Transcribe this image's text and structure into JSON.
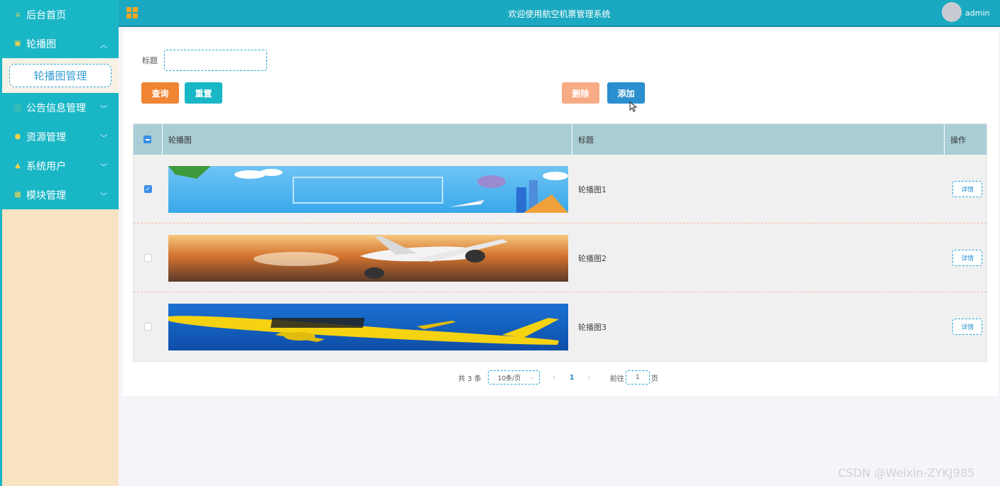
{
  "sidebar": {
    "items": [
      {
        "label": "后台首页",
        "icon": "home-icon"
      },
      {
        "label": "轮播图",
        "icon": "image-icon",
        "expanded": true
      },
      {
        "label": "公告信息管理",
        "icon": "info-icon"
      },
      {
        "label": "资源管理",
        "icon": "pin-icon"
      },
      {
        "label": "系统用户",
        "icon": "user-icon"
      },
      {
        "label": "模块管理",
        "icon": "module-icon"
      }
    ],
    "submenu": {
      "label": "轮播图管理"
    }
  },
  "header": {
    "title": "欢迎使用航空机票管理系统",
    "username": "admin"
  },
  "search": {
    "label": "标题",
    "value": ""
  },
  "buttons": {
    "query": "查询",
    "reset": "重置",
    "delete": "删除",
    "add": "添加"
  },
  "table": {
    "headers": {
      "image": "轮播图",
      "title": "标题",
      "actions": "操作"
    },
    "rows": [
      {
        "title": "轮播图1",
        "checked": true,
        "action": "详情"
      },
      {
        "title": "轮播图2",
        "checked": false,
        "action": "详情"
      },
      {
        "title": "轮播图3",
        "checked": false,
        "action": "详情"
      }
    ]
  },
  "pagination": {
    "total": "共 3 条",
    "page_size": "10条/页",
    "prev": "‹",
    "current": "1",
    "next": "›",
    "goto_prefix": "前往",
    "goto_value": "1",
    "goto_suffix": "页"
  },
  "watermark": "CSDN @Weixin-ZYKJ985",
  "colors": {
    "accent": "#19b6c6",
    "header": "#1aa9c0",
    "sidebar_bg": "#f8e3c3",
    "query_button": "#f08534",
    "delete_button": "#f7ab85",
    "add_button": "#2b8fcf",
    "table_header": "#a9cdd5"
  }
}
